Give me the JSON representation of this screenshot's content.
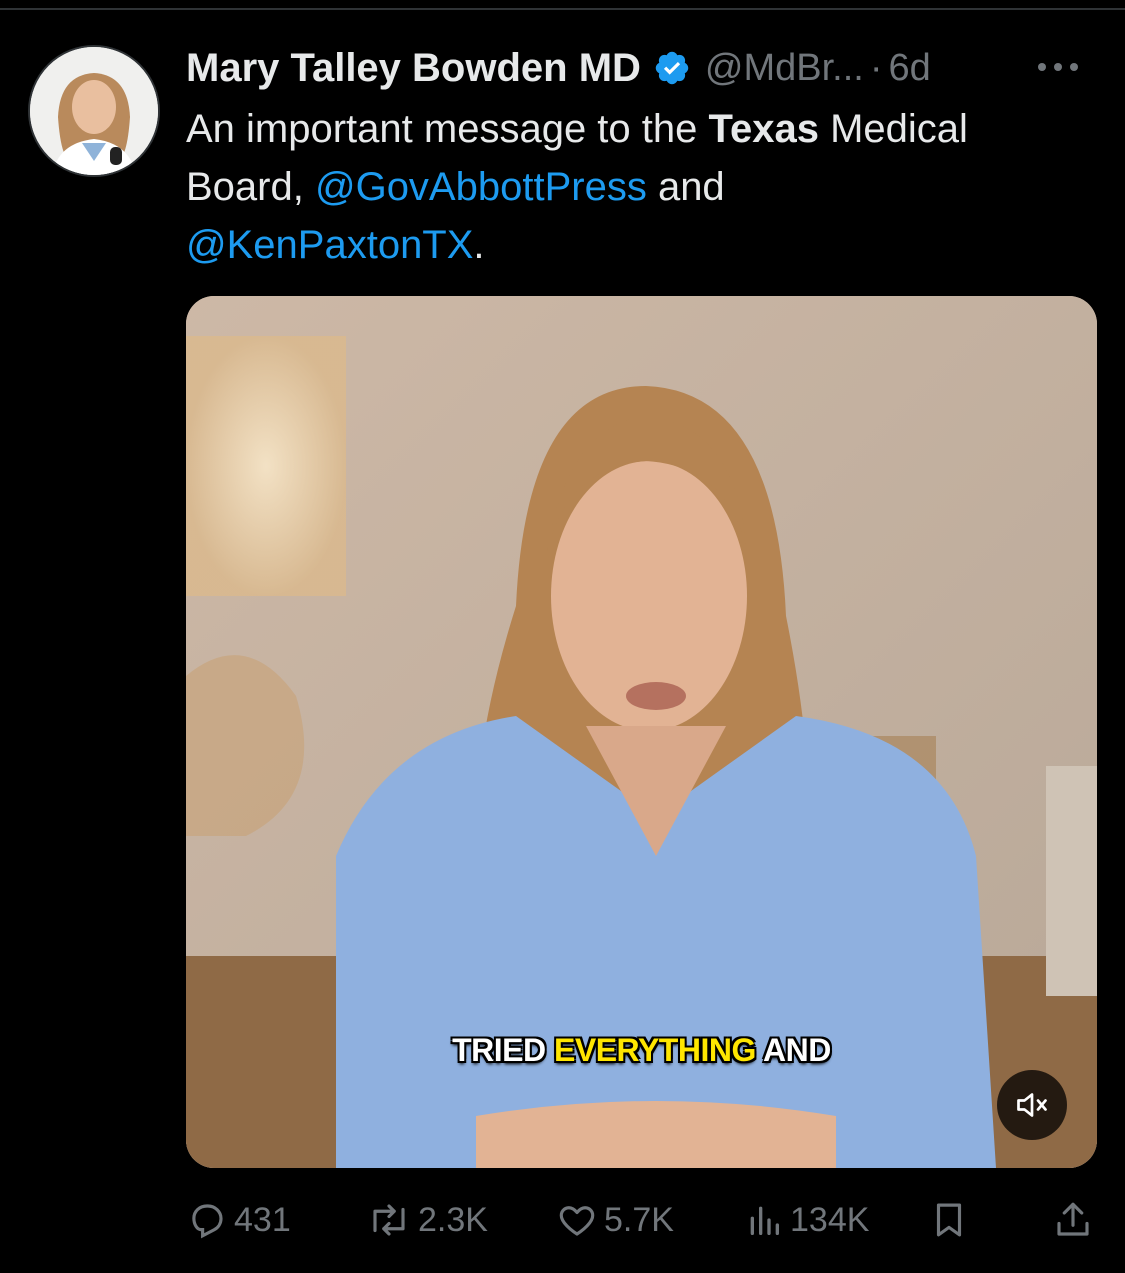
{
  "tweet": {
    "author_name": "Mary Talley Bowden MD",
    "handle": "@MdBr...",
    "separator": "·",
    "time": "6d",
    "text_1": "An important message to the ",
    "text_bold": "Texas",
    "text_2": " Medical Board, ",
    "mention_1": "@GovAbbottPress",
    "text_3": " and ",
    "mention_2": "@KenPaxtonTX",
    "text_4": "."
  },
  "video": {
    "caption_1": "TRIED",
    "caption_highlight": "EVERYTHING",
    "caption_2": "AND"
  },
  "actions": {
    "replies": "431",
    "reposts": "2.3K",
    "likes": "5.7K",
    "views": "134K"
  },
  "icons": [
    "verified-badge-icon",
    "more-icon",
    "mute-icon",
    "reply-icon",
    "repost-icon",
    "like-icon",
    "views-icon",
    "bookmark-icon",
    "share-icon"
  ],
  "colors": {
    "accent": "#1d9bf0",
    "muted": "#71767b",
    "caption_highlight": "#ffe600"
  }
}
